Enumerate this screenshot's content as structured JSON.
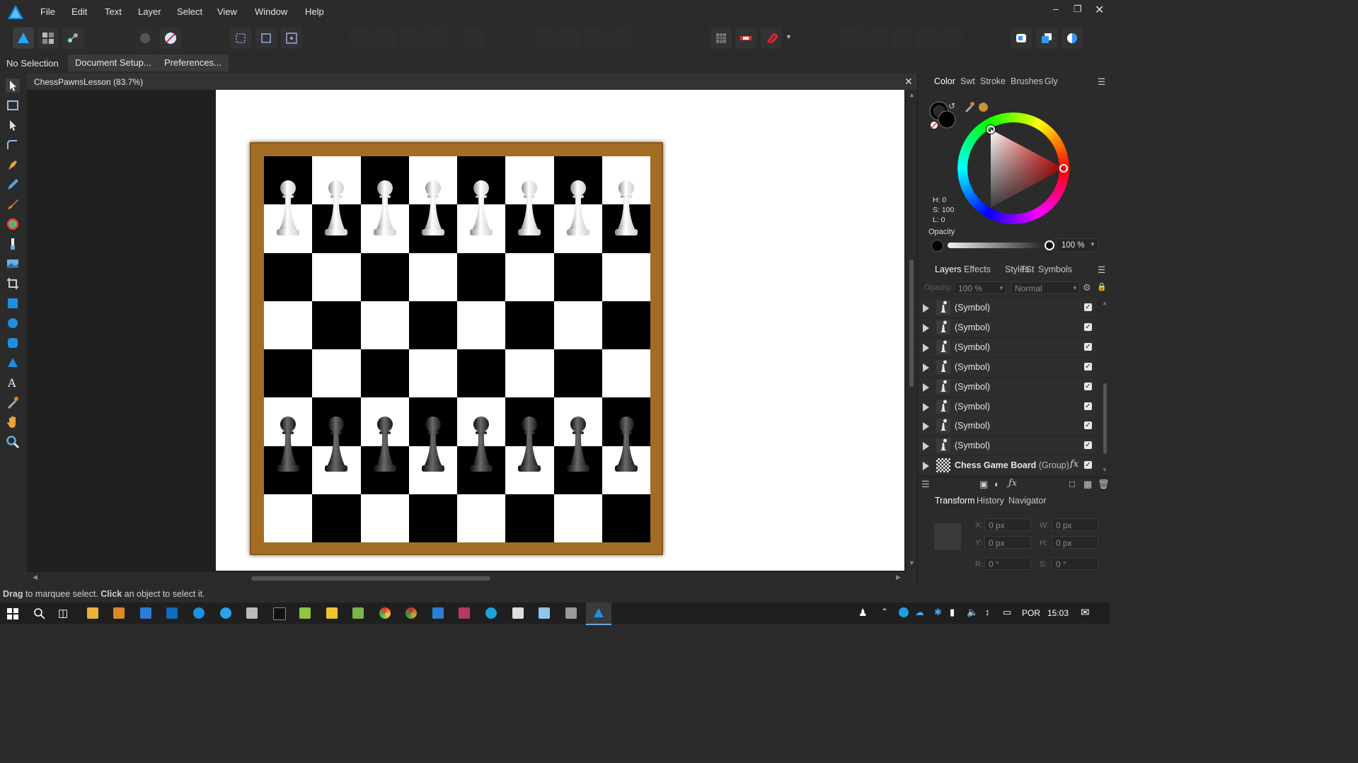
{
  "menubar": {
    "items": [
      "File",
      "Edit",
      "Text",
      "Layer",
      "Select",
      "View",
      "Window",
      "Help"
    ]
  },
  "context": {
    "selection": "No Selection",
    "document_setup": "Document Setup...",
    "preferences": "Preferences..."
  },
  "document": {
    "tab_title": "ChessPawnsLesson (83.7%)"
  },
  "color_panel": {
    "tabs": [
      "Color",
      "Swt",
      "Stroke",
      "Brushes",
      "Gly"
    ],
    "h": "H: 0",
    "s": "S: 100",
    "l": "L: 0",
    "opacity_label": "Opacity",
    "opacity_value": "100 %"
  },
  "layers_panel": {
    "tabs": [
      "Layers",
      "Effects",
      "Styles",
      "TSt",
      "Symbols"
    ],
    "opacity_label": "Opacity:",
    "opacity_value": "100 %",
    "blend_mode": "Normal",
    "rows": [
      {
        "name": "(Symbol)"
      },
      {
        "name": "(Symbol)"
      },
      {
        "name": "(Symbol)"
      },
      {
        "name": "(Symbol)"
      },
      {
        "name": "(Symbol)"
      },
      {
        "name": "(Symbol)"
      },
      {
        "name": "(Symbol)"
      },
      {
        "name": "(Symbol)"
      }
    ],
    "group_row": {
      "name": "Chess Game Board",
      "type": "(Group)",
      "fx": "fx"
    }
  },
  "transform_panel": {
    "tabs": [
      "Transform",
      "History",
      "Navigator"
    ],
    "x_label": "X:",
    "x_value": "0 px",
    "y_label": "Y:",
    "y_value": "0 px",
    "w_label": "W:",
    "w_value": "0 px",
    "h_label": "H:",
    "h_value": "0 px",
    "r_label": "R:",
    "r_value": "0 °",
    "s_label": "S:",
    "s_value": "0 °"
  },
  "statusbar": {
    "drag_word": "Drag",
    "drag_text": " to marquee select. ",
    "click_word": "Click",
    "click_text": " an object to select it."
  },
  "taskbar": {
    "language": "POR",
    "time": "15:03"
  },
  "colors": {
    "board_wood": "#a36d24",
    "accent_orange": "#d8892a",
    "color_wheel_current": "#000000"
  }
}
